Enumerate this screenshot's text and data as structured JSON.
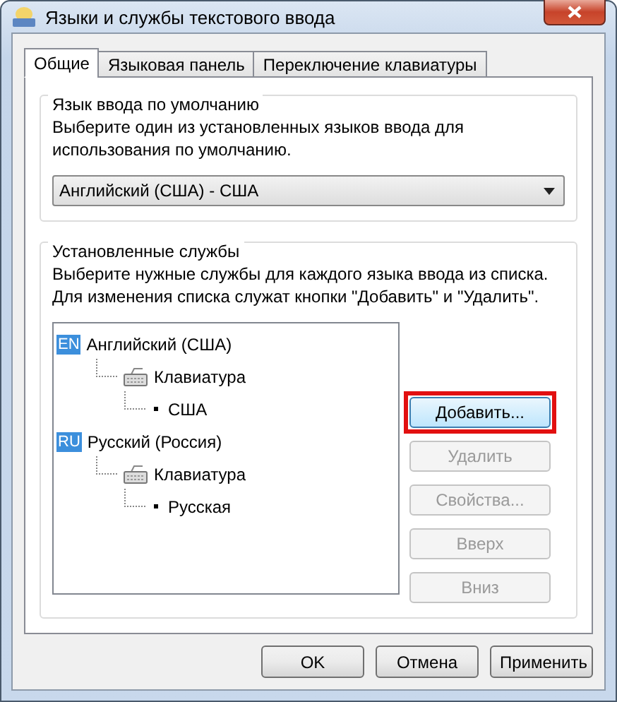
{
  "window": {
    "title": "Языки и службы текстового ввода"
  },
  "tabs": [
    {
      "label": "Общие",
      "selected": true
    },
    {
      "label": "Языковая панель",
      "selected": false
    },
    {
      "label": "Переключение клавиатуры",
      "selected": false
    }
  ],
  "default_language": {
    "title": "Язык ввода по умолчанию",
    "description": "Выберите один из установленных языков ввода для использования по умолчанию.",
    "dropdown": {
      "value": "Английский (США) - США"
    }
  },
  "installed_services": {
    "title": "Установленные службы",
    "description": "Выберите нужные службы для каждого языка ввода из списка. Для изменения списка служат кнопки \"Добавить\" и \"Удалить\".",
    "tree": [
      {
        "kind": "language",
        "badge": "EN",
        "label": "Английский (США)",
        "children": [
          {
            "kind": "keyboard",
            "label": "Клавиатура",
            "children": [
              {
                "kind": "layout",
                "label": "США"
              }
            ]
          }
        ]
      },
      {
        "kind": "language",
        "badge": "RU",
        "label": "Русский (Россия)",
        "children": [
          {
            "kind": "keyboard",
            "label": "Клавиатура",
            "children": [
              {
                "kind": "layout",
                "label": "Русская"
              }
            ]
          }
        ]
      }
    ],
    "buttons": [
      {
        "label": "Добавить...",
        "disabled": false,
        "highlighted": true
      },
      {
        "label": "Удалить",
        "disabled": true,
        "highlighted": false
      },
      {
        "label": "Свойства...",
        "disabled": true,
        "highlighted": false
      },
      {
        "label": "Вверх",
        "disabled": true,
        "highlighted": false
      },
      {
        "label": "Вниз",
        "disabled": true,
        "highlighted": false
      }
    ]
  },
  "buttons": [
    "OK",
    "Отмена",
    "Применить"
  ]
}
